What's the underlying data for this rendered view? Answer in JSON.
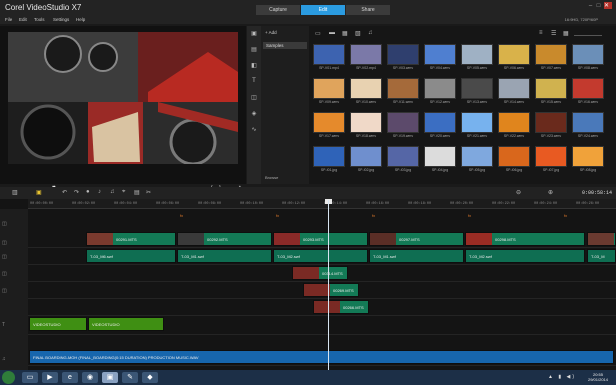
{
  "app": {
    "title": "Corel VideoStudio X7"
  },
  "window_controls": {
    "minimize": "–",
    "maximize": "□",
    "close": "✕"
  },
  "menu": [
    "File",
    "Edit",
    "Tools",
    "Settings",
    "Help"
  ],
  "step_tabs": [
    {
      "label": "Capture"
    },
    {
      "label": "Edit"
    },
    {
      "label": "Share"
    }
  ],
  "project_resolution": "16:9HD, 720P/60P",
  "player": {
    "mode_project": "Project",
    "mode_clip": "Clip",
    "timecode": "00:00:14:02",
    "scrub_progress": 0.23
  },
  "library": {
    "add_label": "Add",
    "selected_folder": "Samples",
    "browse_label": "Browse",
    "thumbs": [
      {
        "label": "SP-V01.mp4",
        "color": "#3d63b0"
      },
      {
        "label": "SP-V02.mp4",
        "color": "#7b79a8"
      },
      {
        "label": "SP-V03.wmv",
        "color": "#2f3f6e"
      },
      {
        "label": "SP-V04.wmv",
        "color": "#4f7fd0"
      },
      {
        "label": "SP-V05.wmv",
        "color": "#9fb1c4"
      },
      {
        "label": "SP-V06.wmv",
        "color": "#d9b24a"
      },
      {
        "label": "SP-V07.wmv",
        "color": "#c98a2c"
      },
      {
        "label": "SP-V08.wmv",
        "color": "#6b8fb8"
      },
      {
        "label": "SP-V09.wmv",
        "color": "#e0a45c"
      },
      {
        "label": "SP-V10.wmv",
        "color": "#e8d2b1"
      },
      {
        "label": "SP-V11.wmv",
        "color": "#a56a3a"
      },
      {
        "label": "SP-V12.wmv",
        "color": "#8b8b8b"
      },
      {
        "label": "SP-V13.wmv",
        "color": "#4a4a4a"
      },
      {
        "label": "SP-V14.wmv",
        "color": "#9aa4b2"
      },
      {
        "label": "SP-V15.wmv",
        "color": "#d0b24f"
      },
      {
        "label": "SP-V16.wmv",
        "color": "#c33a2e"
      },
      {
        "label": "SP-V17.wmv",
        "color": "#e58a2c"
      },
      {
        "label": "SP-V18.wmv",
        "color": "#f0d9c8"
      },
      {
        "label": "SP-V19.wmv",
        "color": "#5c4a6b"
      },
      {
        "label": "SP-V20.wmv",
        "color": "#3b6ec2"
      },
      {
        "label": "SP-V21.wmv",
        "color": "#77b2ee"
      },
      {
        "label": "SP-V22.wmv",
        "color": "#e0851d"
      },
      {
        "label": "SP-V23.wmv",
        "color": "#6a2a1c"
      },
      {
        "label": "SP-V24.wmv",
        "color": "#4a79ba"
      },
      {
        "label": "SP-I01.jpg",
        "color": "#2f63b8"
      },
      {
        "label": "SP-I02.jpg",
        "color": "#6f8fce"
      },
      {
        "label": "SP-I03.jpg",
        "color": "#5566a6"
      },
      {
        "label": "SP-I04.jpg",
        "color": "#dcdcdc"
      },
      {
        "label": "SP-I05.jpg",
        "color": "#7fa8de"
      },
      {
        "label": "SP-I06.jpg",
        "color": "#d9671c"
      },
      {
        "label": "SP-I07.jpg",
        "color": "#e85a22"
      },
      {
        "label": "SP-I08.jpg",
        "color": "#f0a23a"
      }
    ]
  },
  "timeline": {
    "timecode": "0:00:58:14",
    "ruler": [
      "00:00:00:00",
      "00:00:02:00",
      "00:00:04:00",
      "00:00:06:00",
      "00:00:08:00",
      "00:00:10:00",
      "00:00:12:00",
      "00:00:14:00",
      "00:00:16:00",
      "00:00:18:00",
      "00:00:20:00",
      "00:00:22:00",
      "00:00:24:00",
      "00:00:26:00"
    ],
    "video_clips": [
      {
        "label": "00291.MTS",
        "thumb": "#7a3a2e"
      },
      {
        "label": "00292.MTS",
        "thumb": "#3a3a3a"
      },
      {
        "label": "00293.MTS",
        "thumb": "#8a2a28"
      },
      {
        "label": "00297.MTS",
        "thumb": "#5a2e26"
      },
      {
        "label": "00298.MTS",
        "thumb": "#9a2c24"
      },
      {
        "label": "00299.MTS",
        "thumb": "#6a3a30"
      }
    ],
    "title_clips": [
      "T-03_M6.swf",
      "T-03_M1.swf",
      "T-03_M2.swf",
      "T-03_M1.swf",
      "T-03_M2.swf",
      "T-03_M"
    ],
    "overlay_clips": [
      "00314.MTS",
      "00269.MTS",
      "00266.MTS"
    ],
    "text_clips": [
      "VIDEOSTUDIO",
      "VIDEOSTUDIO"
    ],
    "music_clip": "FINAL BOARDING-MOH (FINAL_BOARDING(0:15 DURATION) PRODUCTION MUSIC.WAV"
  },
  "taskbar": {
    "time": "20:55",
    "date": "29/01/2014"
  },
  "colors": {
    "accent": "#2b9be0",
    "clip_green": "#137a56",
    "clip_blue": "#1766ad",
    "clip_lime": "#3f8f13",
    "scrub": "#e0830c"
  }
}
